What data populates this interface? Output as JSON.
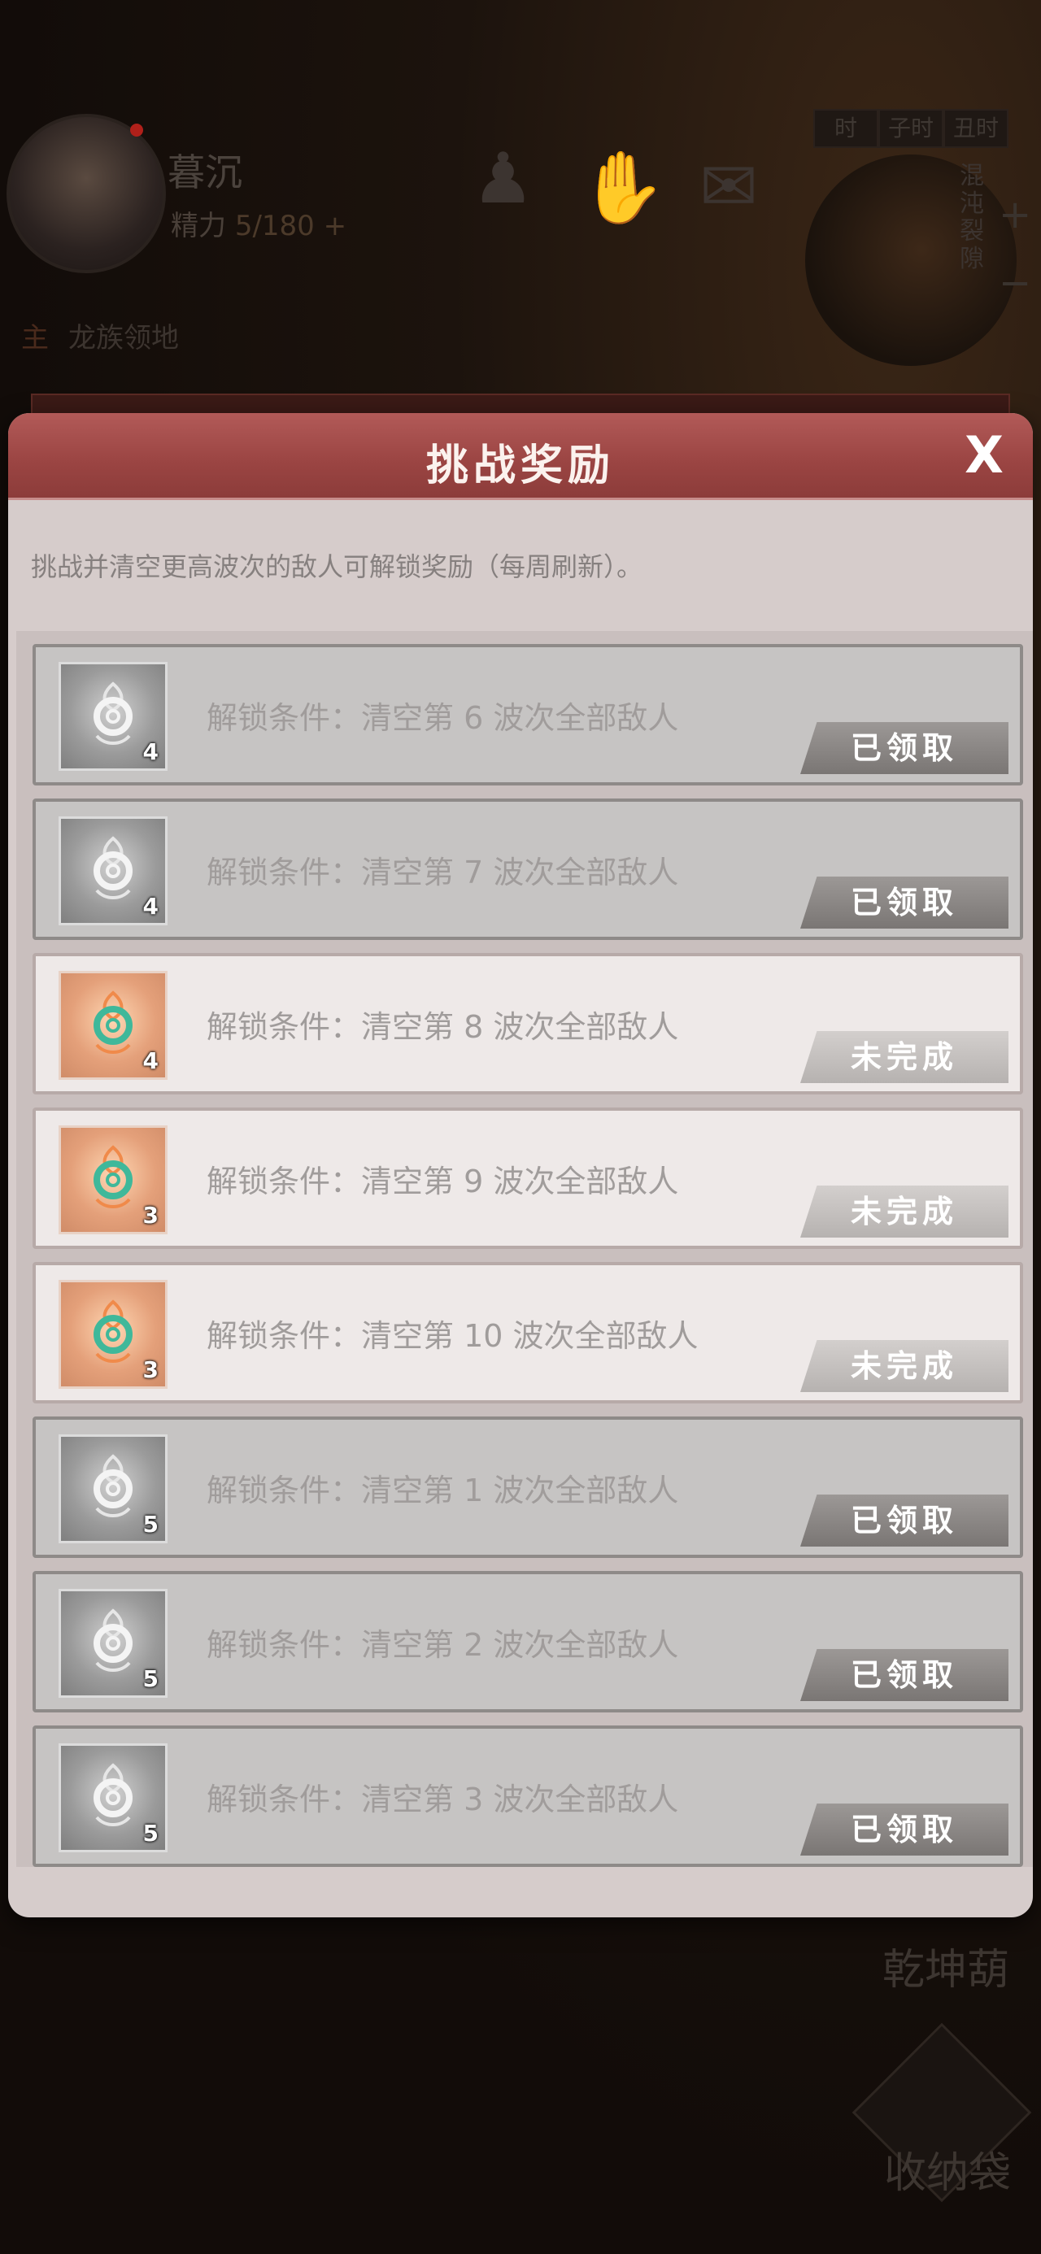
{
  "background": {
    "player_name": "暮沉",
    "energy_label": "精力",
    "energy_value": "5/180",
    "energy_add": "+",
    "region_tag": "主",
    "region_name": "龙族领地",
    "time_slots": [
      "时",
      "子时",
      "丑时"
    ],
    "side_label": "混沌裂隙",
    "zoom_plus": "+",
    "zoom_minus": "−",
    "gourd_label": "乾坤葫",
    "bag_label": "收纳袋"
  },
  "modal": {
    "title": "挑战奖励",
    "close_label": "X",
    "description": "挑战并清空更高波次的敌人可解锁奖励（每周刷新）。"
  },
  "rewards": [
    {
      "condition": "解锁条件：清空第 6 波次全部敌人",
      "count": "4",
      "status": "已领取"
    },
    {
      "condition": "解锁条件：清空第 7 波次全部敌人",
      "count": "4",
      "status": "已领取"
    },
    {
      "condition": "解锁条件：清空第 8 波次全部敌人",
      "count": "4",
      "status": "未完成"
    },
    {
      "condition": "解锁条件：清空第 9 波次全部敌人",
      "count": "3",
      "status": "未完成"
    },
    {
      "condition": "解锁条件：清空第 10 波次全部敌人",
      "count": "3",
      "status": "未完成"
    },
    {
      "condition": "解锁条件：清空第 1 波次全部敌人",
      "count": "5",
      "status": "已领取"
    },
    {
      "condition": "解锁条件：清空第 2 波次全部敌人",
      "count": "5",
      "status": "已领取"
    },
    {
      "condition": "解锁条件：清空第 3 波次全部敌人",
      "count": "5",
      "status": "已领取"
    }
  ],
  "colors": {
    "header": "#9a4442",
    "claimed_row": "#c6c4c3",
    "pending_row": "#eee9e8"
  }
}
